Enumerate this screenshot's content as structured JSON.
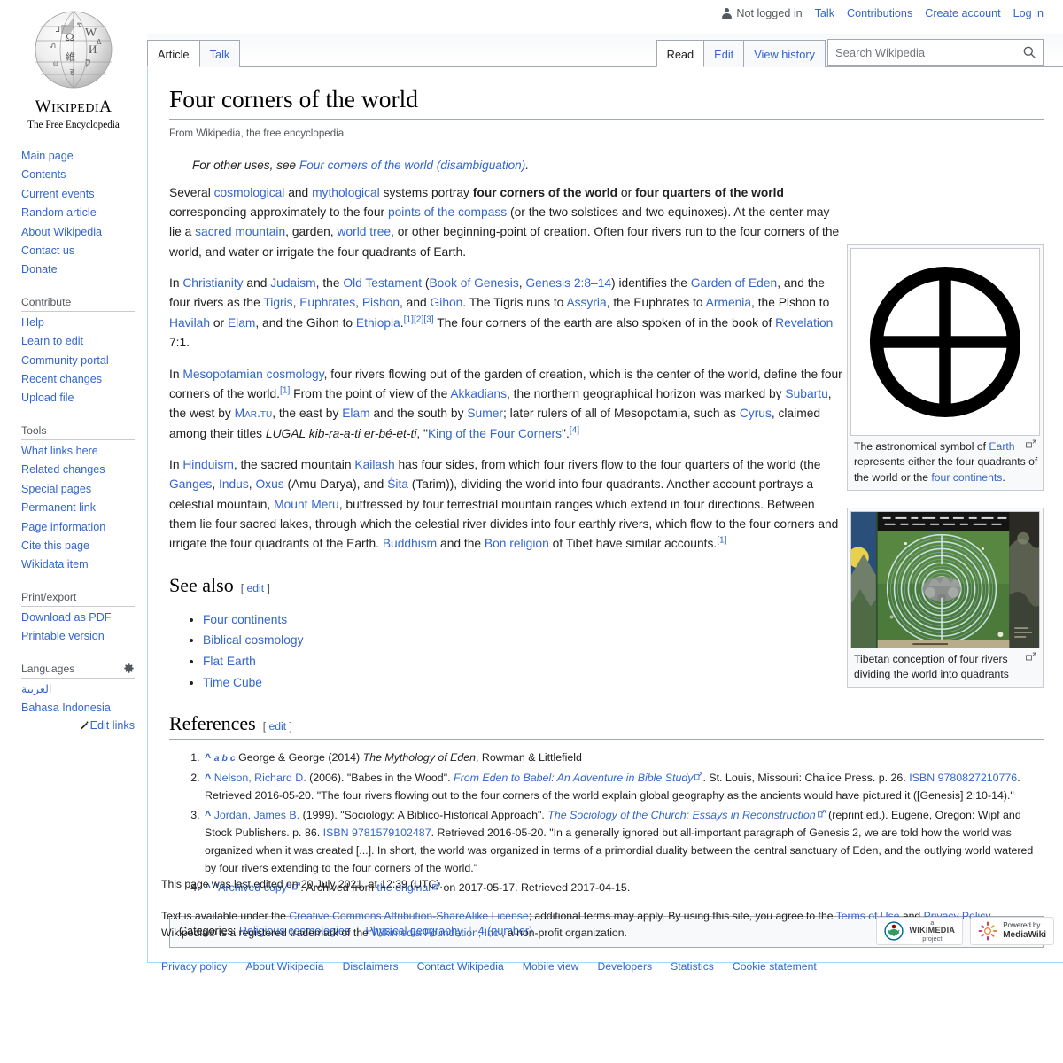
{
  "personal_bar": {
    "not_logged_in": "Not logged in",
    "links": [
      "Talk",
      "Contributions",
      "Create account",
      "Log in"
    ]
  },
  "logo": {
    "wordmark_w": "W",
    "wordmark_rest": "IKIPEDI",
    "wordmark_a": "A",
    "tagline": "The Free Encyclopedia"
  },
  "tabs": {
    "namespaces": [
      {
        "label": "Article",
        "selected": true
      },
      {
        "label": "Talk",
        "selected": false
      }
    ],
    "views": [
      {
        "label": "Read",
        "selected": true
      },
      {
        "label": "Edit",
        "selected": false
      },
      {
        "label": "View history",
        "selected": false
      }
    ]
  },
  "search": {
    "placeholder": "Search Wikipedia",
    "value": ""
  },
  "sidebar": {
    "navigation": {
      "items": [
        "Main page",
        "Contents",
        "Current events",
        "Random article",
        "About Wikipedia",
        "Contact us",
        "Donate"
      ]
    },
    "contribute": {
      "heading": "Contribute",
      "items": [
        "Help",
        "Learn to edit",
        "Community portal",
        "Recent changes",
        "Upload file"
      ]
    },
    "tools": {
      "heading": "Tools",
      "items": [
        "What links here",
        "Related changes",
        "Special pages",
        "Permanent link",
        "Page information",
        "Cite this page",
        "Wikidata item"
      ]
    },
    "print_export": {
      "heading": "Print/export",
      "items": [
        "Download as PDF",
        "Printable version"
      ]
    },
    "languages": {
      "heading": "Languages",
      "items": [
        "العربية",
        "Bahasa Indonesia"
      ],
      "edit_links": "Edit links"
    }
  },
  "article": {
    "title": "Four corners of the world",
    "site_sub": "From Wikipedia, the free encyclopedia",
    "hatnote_pre": "For other uses, see ",
    "hatnote_link": "Four corners of the world (disambiguation)",
    "hatnote_post": ".",
    "para1": {
      "t1": "Several ",
      "l1": "cosmological",
      "t2": " and ",
      "l2": "mythological",
      "t3": " systems portray ",
      "b1": "four corners of the world",
      "t4": " or ",
      "b2": "four quarters of the world",
      "t5": " corresponding approximately to the four ",
      "l3": "points of the compass",
      "t6": " (or the two solstices and two equinoxes). At the center may lie a ",
      "l4": "sacred mountain",
      "t7": ", garden, ",
      "l5": "world tree",
      "t8": ", or other beginning-point of creation. Often four rivers run to the four corners of the world, and water or irrigate the four quadrants of Earth."
    },
    "para2": {
      "t1": "In ",
      "l1": "Christianity",
      "t2": " and ",
      "l2": "Judaism",
      "t3": ", the ",
      "l3": "Old Testament",
      "t4": " (",
      "l4": "Book of Genesis",
      "t5": ", ",
      "l5": "Genesis 2:8–14",
      "t6": ") identifies the ",
      "l6": "Garden of Eden",
      "t7": ", and the four rivers as the ",
      "l7": "Tigris",
      "t8": ", ",
      "l8": "Euphrates",
      "t9": ", ",
      "l9": "Pishon",
      "t10": ", and ",
      "l10": "Gihon",
      "t11": ". The Tigris runs to ",
      "l11": "Assyria",
      "t12": ", the Euphrates to ",
      "l12": "Armenia",
      "t13": ", the Pishon to ",
      "l13": "Havilah",
      "t14": " or ",
      "l14": "Elam",
      "t15": ", and the Gihon to ",
      "l15": "Ethiopia",
      "t16": ".",
      "refs": [
        "[1]",
        "[2]",
        "[3]"
      ],
      "t17": " The four corners of the earth are also spoken of in the book of ",
      "l16": "Revelation",
      "t18": " 7:1."
    },
    "para3": {
      "t1": "In ",
      "l1": "Mesopotamian cosmology",
      "t2": ", four rivers flowing out of the garden of creation, which is the center of the world, define the four corners of the world.",
      "ref1": "[1]",
      "t3": " From the point of view of the ",
      "l2": "Akkadians",
      "t4": ", the northern geographical horizon was marked by ",
      "l3": "Subartu",
      "t5": ", the west by ",
      "l4": "Mar.tu",
      "t6": ", the east by ",
      "l5": "Elam",
      "t7": " and the south by ",
      "l6": "Sumer",
      "t8": "; later rulers of all of Mesopotamia, such as ",
      "l7": "Cyrus",
      "t9": ", claimed among their titles ",
      "i1": "LUGAL",
      "i2": " kib-ra-a-ti er-bé-et-ti",
      "t10": ", \"",
      "l8": "King of the Four Corners",
      "t11": "\".",
      "ref2": "[4]"
    },
    "para4": {
      "t1": "In ",
      "l1": "Hinduism",
      "t2": ", the sacred mountain ",
      "l2": "Kailash",
      "t3": " has four sides, from which four rivers flow to the four quarters of the world (the ",
      "l3": "Ganges",
      "t4": ", ",
      "l4": "Indus",
      "t5": ", ",
      "l5": "Oxus",
      "t6": " (Amu Darya), and ",
      "l6": "Śita",
      "t7": " (Tarim)), dividing the world into four quadrants. Another account portrays a celestial mountain, ",
      "l7": "Mount Meru",
      "t8": ", buttressed by four terrestrial mountain ranges which extend in four directions. Between them lie four sacred lakes, through which the celestial river divides into four earthly rivers, which flow to the four corners and irrigate the four quadrants of the Earth. ",
      "l8": "Buddhism",
      "t9": " and the ",
      "l9": "Bon religion",
      "t10": " of Tibet have similar accounts.",
      "ref1": "[1]"
    }
  },
  "thumbs": {
    "earth": {
      "caption_t1": "The astronomical symbol of ",
      "caption_l1": "Earth",
      "caption_t2": " represents either the four quadrants of the world or the ",
      "caption_l2": "four continents",
      "caption_t3": "."
    },
    "tibet": {
      "caption": "Tibetan conception of four rivers dividing the world into quadrants"
    }
  },
  "see_also": {
    "heading": "See also",
    "edit": "edit",
    "items": [
      "Four continents",
      "Biblical cosmology",
      "Flat Earth",
      "Time Cube"
    ]
  },
  "references": {
    "heading": "References",
    "edit": "edit",
    "items": [
      {
        "n": "1",
        "backlinks": "a b c",
        "parts": [
          {
            "type": "text",
            "v": "George & George (2014) "
          },
          {
            "type": "italic",
            "v": "The Mythology of Eden"
          },
          {
            "type": "text",
            "v": ", Rowman & Littlefield"
          }
        ]
      },
      {
        "n": "2",
        "parts": [
          {
            "type": "link",
            "v": "Nelson, Richard D."
          },
          {
            "type": "text",
            "v": " (2006). \"Babes in the Wood\". "
          },
          {
            "type": "extlink-italic",
            "v": "From Eden to Babel: An Adventure in Bible Study"
          },
          {
            "type": "text",
            "v": ". St. Louis, Missouri: Chalice Press. p. 26. "
          },
          {
            "type": "link",
            "v": "ISBN"
          },
          {
            "type": "text",
            "v": " "
          },
          {
            "type": "link",
            "v": "9780827210776"
          },
          {
            "type": "text",
            "v": ". Retrieved 2016-05-20. \"The four rivers flowing out to the four corners of the world explain global geography as the ancients would have pictured it ([Genesis] 2:10-14).\""
          }
        ]
      },
      {
        "n": "3",
        "parts": [
          {
            "type": "link",
            "v": "Jordan, James B."
          },
          {
            "type": "text",
            "v": " (1999). \"Sociology: A Biblico-Historical Approach\". "
          },
          {
            "type": "extlink-italic",
            "v": "The Sociology of the Church: Essays in Reconstruction"
          },
          {
            "type": "text",
            "v": " (reprint ed.). Eugene, Oregon: Wipf and Stock Publishers. p. 86. "
          },
          {
            "type": "link",
            "v": "ISBN"
          },
          {
            "type": "text",
            "v": " "
          },
          {
            "type": "link",
            "v": "9781579102487"
          },
          {
            "type": "text",
            "v": ". Retrieved 2016-05-20. \"In a generally ignored but all-important paragraph of Genesis 2, we are told how the world was organized when it was created [...]. In short, the world was organized in terms of a primordial duality between the central sanctuary of Eden, and the outlying world watered by four rivers extending to the four corners of the world.\""
          }
        ]
      },
      {
        "n": "4",
        "parts": [
          {
            "type": "extlink",
            "v": "\"Archived copy\""
          },
          {
            "type": "text",
            "v": ". Archived from "
          },
          {
            "type": "extlink",
            "v": "the original"
          },
          {
            "type": "text",
            "v": " on 2017-05-17. Retrieved 2017-04-15."
          }
        ]
      }
    ]
  },
  "categories": {
    "label": "Categories",
    "items": [
      "Religious cosmologies",
      "Physical geography",
      "4 (number)"
    ]
  },
  "footer": {
    "last_modified": "This page was last edited on 20 July 2021, at 12:39 (UTC).",
    "credit_t1": "Text is available under the ",
    "credit_l1": "Creative Commons Attribution-ShareAlike License",
    "credit_t2": "; additional terms may apply. By using this site, you agree to the ",
    "credit_l2": "Terms of Use",
    "credit_t3": " and ",
    "credit_l3": "Privacy Policy",
    "credit_t4": ". Wikipedia® is a registered trademark of the ",
    "credit_l4": "Wikimedia Foundation, Inc.",
    "credit_t5": ", a non-profit organization.",
    "places": [
      "Privacy policy",
      "About Wikipedia",
      "Disclaimers",
      "Contact Wikipedia",
      "Mobile view",
      "Developers",
      "Statistics",
      "Cookie statement"
    ],
    "badge_wikimedia_a": "a",
    "badge_wikimedia_name": "WIKIMEDIA",
    "badge_wikimedia_project": "project",
    "badge_mediawiki_powered": "Powered by",
    "badge_mediawiki_name": "MediaWiki"
  },
  "colors": {
    "link": "#3366cc",
    "border": "#a2a9b1",
    "tab_border": "#a7d7f9",
    "bg_light": "#f8f9fa"
  }
}
